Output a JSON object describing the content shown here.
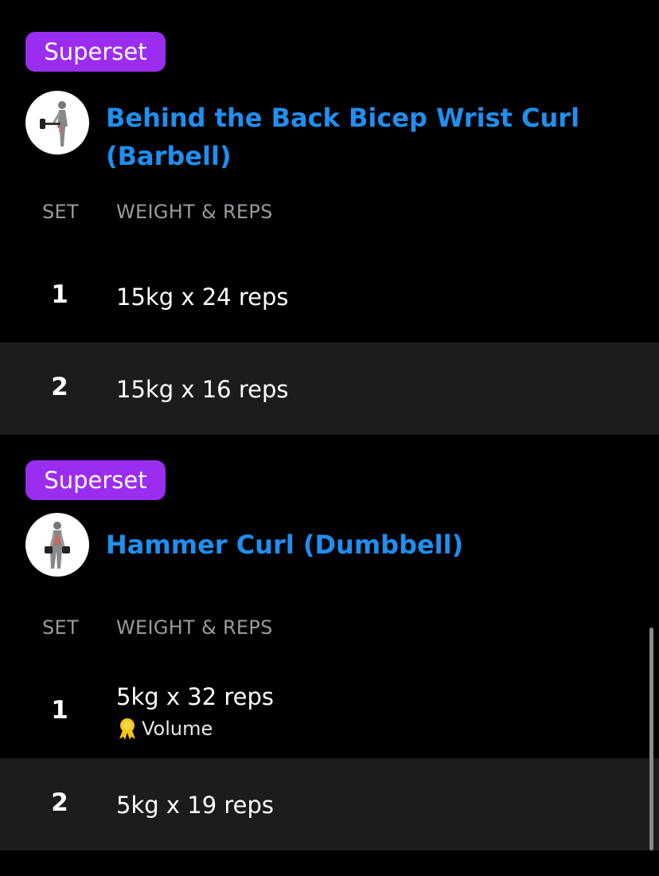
{
  "exercises": [
    {
      "badge": "Superset",
      "title_line1": "Behind the Back Bicep Wrist Curl",
      "title_line2": "(Barbell)",
      "headers": {
        "set": "SET",
        "weight_reps": "WEIGHT & REPS"
      },
      "sets": [
        {
          "number": "1",
          "value": "15kg x 24 reps"
        },
        {
          "number": "2",
          "value": "15kg x 16 reps"
        }
      ]
    },
    {
      "badge": "Superset",
      "title": "Hammer Curl (Dumbbell)",
      "headers": {
        "set": "SET",
        "weight_reps": "WEIGHT & REPS"
      },
      "sets": [
        {
          "number": "1",
          "value": "5kg x 32 reps",
          "record": "Volume"
        },
        {
          "number": "2",
          "value": "5kg x 19 reps"
        }
      ]
    }
  ],
  "colors": {
    "background": "#000000",
    "badge": "#9b2df0",
    "title": "#1f8ff0",
    "alt_row": "#1c1c1e",
    "header_text": "#9a9aa0",
    "medal": "#f5c518"
  },
  "icons": {
    "exercise_1": "barbell-curl-figure-icon",
    "exercise_2": "dumbbell-curl-figure-icon",
    "record": "medal-icon"
  }
}
